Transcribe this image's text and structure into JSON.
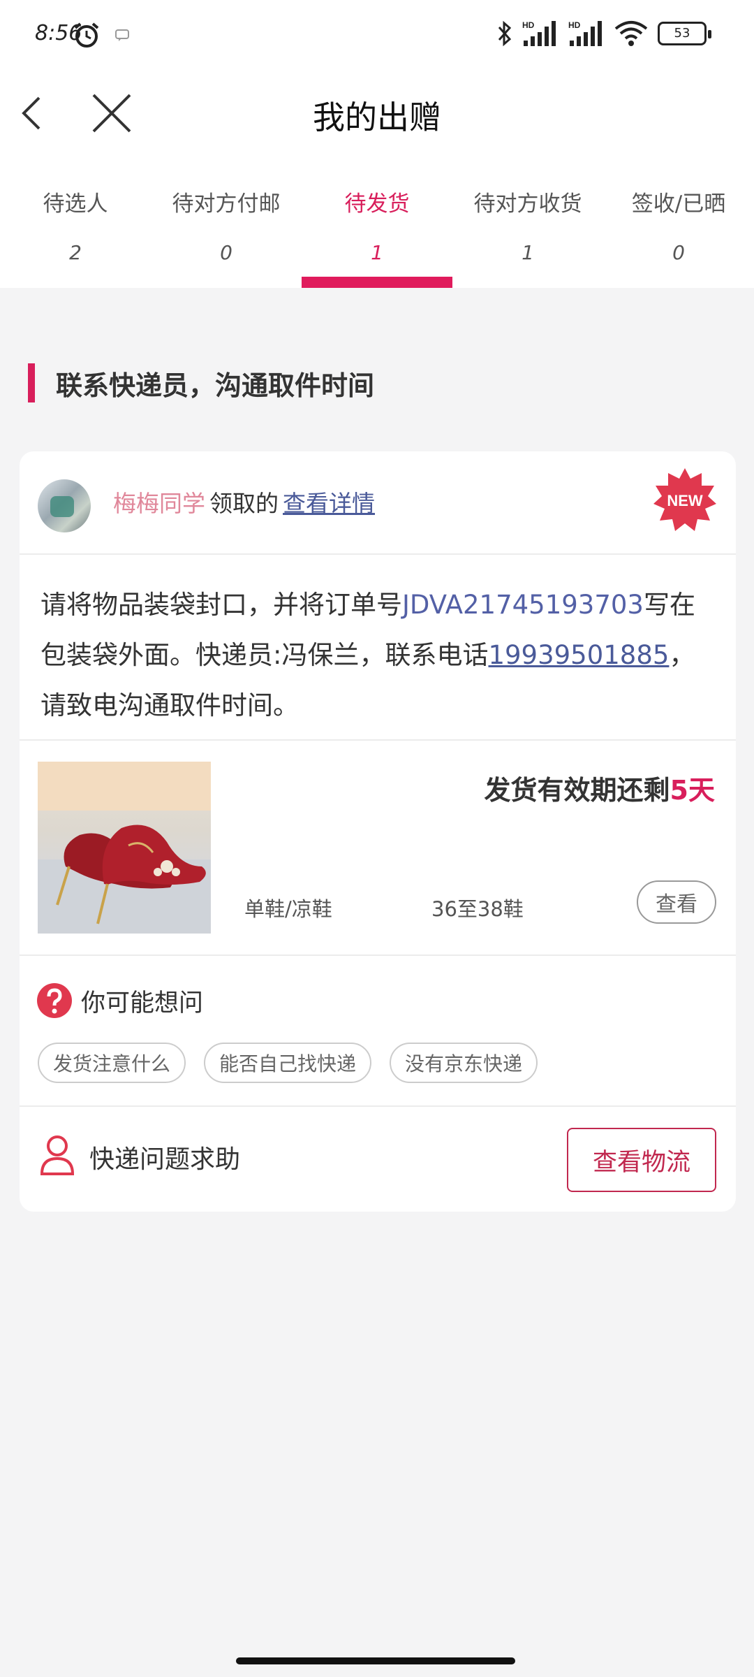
{
  "status_bar": {
    "time": "8:56",
    "battery": "53",
    "icons": [
      "alarm-icon",
      "message-icon",
      "bluetooth-icon",
      "signal-hd-icon",
      "signal-hd-icon",
      "wifi-icon",
      "battery-icon"
    ]
  },
  "nav": {
    "title": "我的出赠",
    "back_icon": "chevron-left-icon",
    "close_icon": "close-icon"
  },
  "tabs": [
    {
      "label": "待选人",
      "count": "2",
      "active": false
    },
    {
      "label": "待对方付邮",
      "count": "0",
      "active": false
    },
    {
      "label": "待发货",
      "count": "1",
      "active": true
    },
    {
      "label": "待对方收货",
      "count": "1",
      "active": false
    },
    {
      "label": "签收/已晒",
      "count": "0",
      "active": false
    }
  ],
  "section": {
    "title": "联系快递员，沟通取件时间"
  },
  "card": {
    "user": {
      "name": "梅梅同学",
      "action": "领取的",
      "link": "查看详情",
      "badge": "NEW"
    },
    "notice": {
      "part1": "请将物品装袋封口，并将订单号",
      "order_no": "JDVA21745193703",
      "part2": "写在包装袋外面。快递员:冯保兰，联系电话",
      "phone": "19939501885",
      "part3": "，请致电沟通取件时间。"
    },
    "product": {
      "title_prefix": "发货有效期还剩",
      "days": "5天",
      "category": "单鞋/凉鞋",
      "size": "36至38鞋",
      "view_label": "查看"
    },
    "faq": {
      "title": "你可能想问",
      "chips": [
        "发货注意什么",
        "能否自己找快递",
        "没有京东快递"
      ]
    },
    "help": {
      "label": "快递问题求助",
      "button": "查看物流"
    }
  },
  "colors": {
    "accent": "#d81e5b",
    "link": "#4a5a99",
    "background": "#f4f4f5"
  }
}
